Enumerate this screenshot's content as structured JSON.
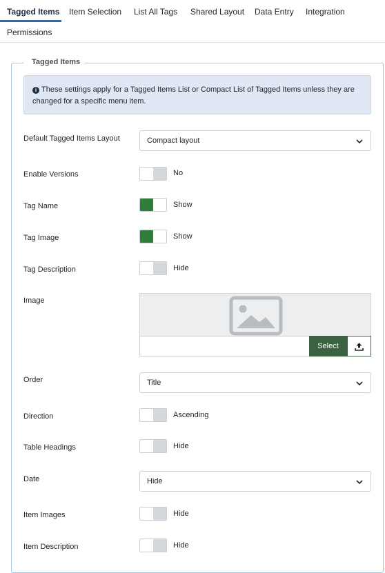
{
  "tabs": [
    {
      "label": "Tagged Items",
      "active": true
    },
    {
      "label": "Item Selection"
    },
    {
      "label": "List All Tags"
    },
    {
      "label": "Shared Layout"
    },
    {
      "label": "Data Entry"
    },
    {
      "label": "Integration"
    },
    {
      "label": "Permissions"
    }
  ],
  "fieldset": {
    "legend": "Tagged Items",
    "info": "These settings apply for a Tagged Items List or Compact List of Tagged Items unless they are changed for a specific menu item."
  },
  "fields": {
    "layout": {
      "label": "Default Tagged Items Layout",
      "value": "Compact layout"
    },
    "versions": {
      "label": "Enable Versions",
      "state": "No"
    },
    "tag_name": {
      "label": "Tag Name",
      "state": "Show"
    },
    "tag_image": {
      "label": "Tag Image",
      "state": "Show"
    },
    "tag_description": {
      "label": "Tag Description",
      "state": "Hide"
    },
    "image": {
      "label": "Image",
      "select_label": "Select"
    },
    "order": {
      "label": "Order",
      "value": "Title"
    },
    "direction": {
      "label": "Direction",
      "state": "Ascending"
    },
    "table_headings": {
      "label": "Table Headings",
      "state": "Hide"
    },
    "date": {
      "label": "Date",
      "value": "Hide"
    },
    "item_images": {
      "label": "Item Images",
      "state": "Hide"
    },
    "item_description": {
      "label": "Item Description",
      "state": "Hide"
    }
  },
  "colors": {
    "accent": "#2a69b8",
    "toggle_on": "#2f7d3b",
    "select_button": "#3b6341"
  }
}
